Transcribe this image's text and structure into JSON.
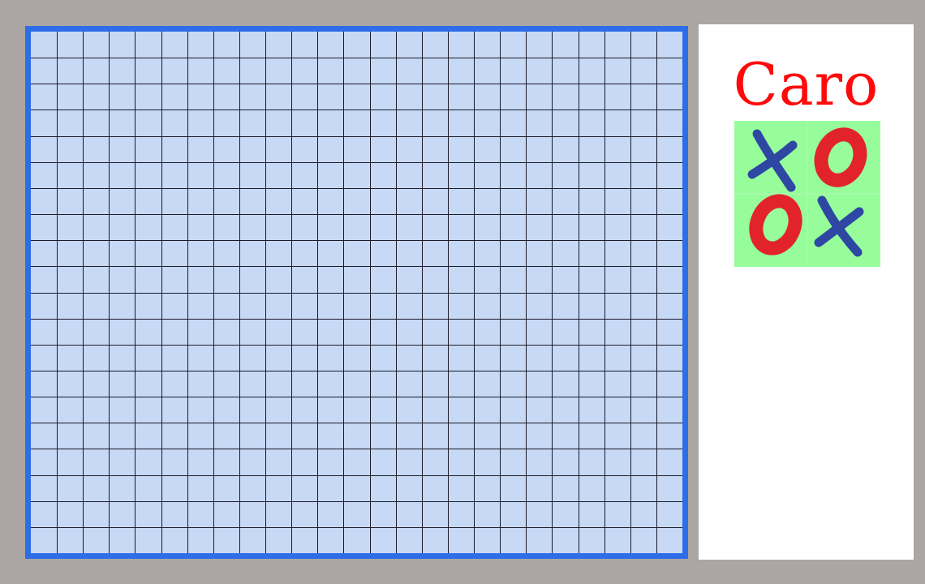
{
  "title": "Caro",
  "colors": {
    "background": "#aba6a3",
    "board_border": "#2d6de8",
    "board_fill": "#c7d9f5",
    "grid_line": "#1a1a2a",
    "panel": "#ffffff",
    "title": "#ff0a0a",
    "logo_background": "#96fd9a",
    "x_mark": "#2d47a3",
    "o_mark": "#e3232c"
  },
  "board": {
    "columns": 25,
    "rows": 20
  },
  "logo": {
    "cells": [
      "x-icon",
      "o-icon",
      "o-icon",
      "x-icon"
    ]
  }
}
